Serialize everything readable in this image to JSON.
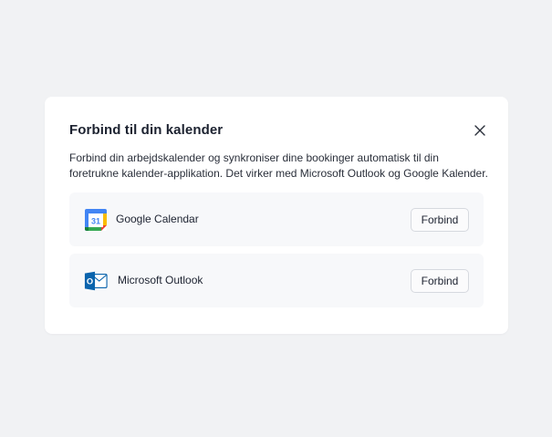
{
  "modal": {
    "title": "Forbind til din kalender",
    "description": "Forbind din arbejdskalender og synkroniser dine bookinger automatisk til din foretrukne kalender-applikation. Det virker med Microsoft Outlook og Google Kalender.",
    "close_icon": "close-icon"
  },
  "providers": [
    {
      "name": "Google Calendar",
      "icon": "google-calendar-icon",
      "icon_text": "31",
      "button_label": "Forbind"
    },
    {
      "name": "Microsoft Outlook",
      "icon": "microsoft-outlook-icon",
      "icon_text": "O",
      "button_label": "Forbind"
    }
  ],
  "colors": {
    "page_background": "#f1f2f4",
    "modal_background": "#ffffff",
    "row_background": "#f7f8fa",
    "text": "#1c2230"
  }
}
